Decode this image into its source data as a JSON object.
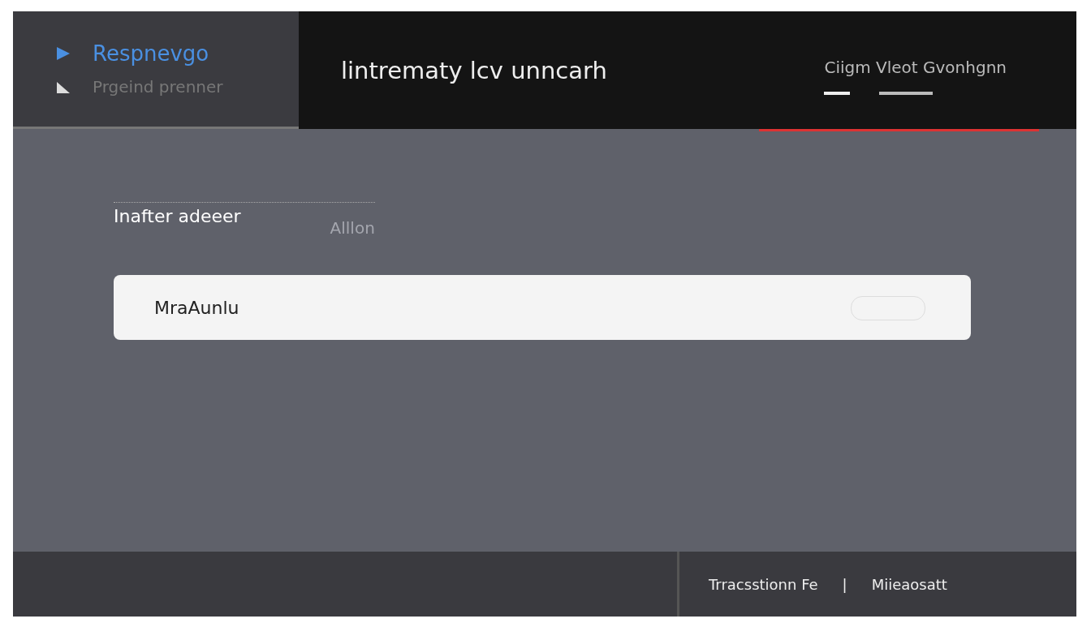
{
  "nav": [
    {
      "label": "Respnevgo",
      "selected": true
    },
    {
      "label": "Prgeind prenner",
      "selected": false
    }
  ],
  "header": {
    "title": "lintrematy lcv unncarh",
    "account": "Ciigm Vleot Gvonhgnn"
  },
  "form": {
    "label": "Inafter adeeer",
    "hint": "Alllon",
    "value": "MraAunlu"
  },
  "footer": {
    "left": "Trracsstionn Fe",
    "separator": "|",
    "right": "Miieaosatt"
  }
}
